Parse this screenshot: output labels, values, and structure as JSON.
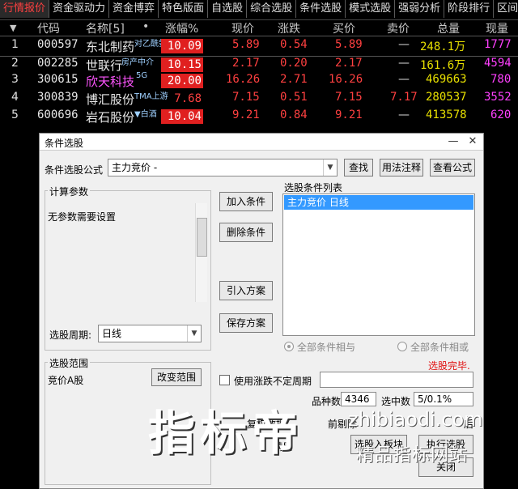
{
  "tabs": [
    "行情报价",
    "资金驱动力",
    "资金博弈",
    "特色版面",
    "自选股",
    "综合选股",
    "条件选股",
    "模式选股",
    "强弱分析",
    "阶段排行",
    "区间"
  ],
  "header": {
    "arrow": "▼",
    "code": "代码",
    "name": "名称[5]",
    "dot": "•",
    "chg": "涨幅%",
    "price": "现价",
    "change": "涨跌",
    "bid": "买价",
    "ask": "卖价",
    "vol": "总量",
    "cur": "现量"
  },
  "rows": [
    {
      "idx": "1",
      "code": "000597",
      "name": "东北制药",
      "tag": "对乙酰氨基酚",
      "chg": "10.09",
      "price": "5.89",
      "change": "0.54",
      "bid": "5.89",
      "ask": "—",
      "vol": "248.1万",
      "cur": "1777"
    },
    {
      "idx": "2",
      "code": "002285",
      "name": "世联行",
      "tag": "房产中介",
      "chg": "10.15",
      "price": "2.17",
      "change": "0.20",
      "bid": "2.17",
      "ask": "—",
      "vol": "161.6万",
      "cur": "4594"
    },
    {
      "idx": "3",
      "code": "300615",
      "name": "欣天科技",
      "tag": "5G",
      "chg": "20.00",
      "price": "16.26",
      "change": "2.71",
      "bid": "16.26",
      "ask": "—",
      "vol": "469663",
      "cur": "780"
    },
    {
      "idx": "4",
      "code": "300839",
      "name": "博汇股份",
      "tag": "TMA上游",
      "chg": "7.68",
      "price": "7.15",
      "change": "0.51",
      "bid": "7.15",
      "ask": "7.17",
      "vol": "280537",
      "cur": "3552"
    },
    {
      "idx": "5",
      "code": "600696",
      "name": "岩石股份",
      "tag": "▼白酒",
      "chg": "10.04",
      "price": "9.21",
      "change": "0.84",
      "bid": "9.21",
      "ask": "—",
      "vol": "413578",
      "cur": "620"
    }
  ],
  "dialog": {
    "title": "条件选股",
    "minimize": "—",
    "close": "✕",
    "formula_label": "条件选股公式",
    "formula_value": "主力竞价 -",
    "find": "查找",
    "usage": "用法注释",
    "view": "查看公式",
    "params_title": "计算参数",
    "params_text": "无参数需要设置",
    "period_label": "选股周期:",
    "period_value": "日线",
    "add": "加入条件",
    "delete": "删除条件",
    "import": "引入方案",
    "save": "保存方案",
    "list_title": "选股条件列表",
    "list_items": [
      "主力竞价  日线"
    ],
    "radio_and": "全部条件相与",
    "radio_or": "全部条件相或",
    "status": "选股完毕.",
    "range_title": "选股范围",
    "range_value": "竞价A股",
    "change_range": "改变范围",
    "uncertain": "使用涨跌不定周期",
    "count_label": "品种数",
    "count_value": "4346",
    "selected_label": "选中数",
    "selected_value": "5/0.1%",
    "fq_label": "复权数据",
    "pre_label": "前剔除",
    "after_label": "后",
    "full_label": "满足",
    "to_block": "选股入板块",
    "run": "执行选股",
    "close_btn": "关闭",
    "colors": {
      "selection": "#3399ff",
      "status": "#e01010"
    }
  },
  "watermark": {
    "big": "指标帝",
    "url": "zhibiaodi.com",
    "sub": "精品指标网站"
  }
}
